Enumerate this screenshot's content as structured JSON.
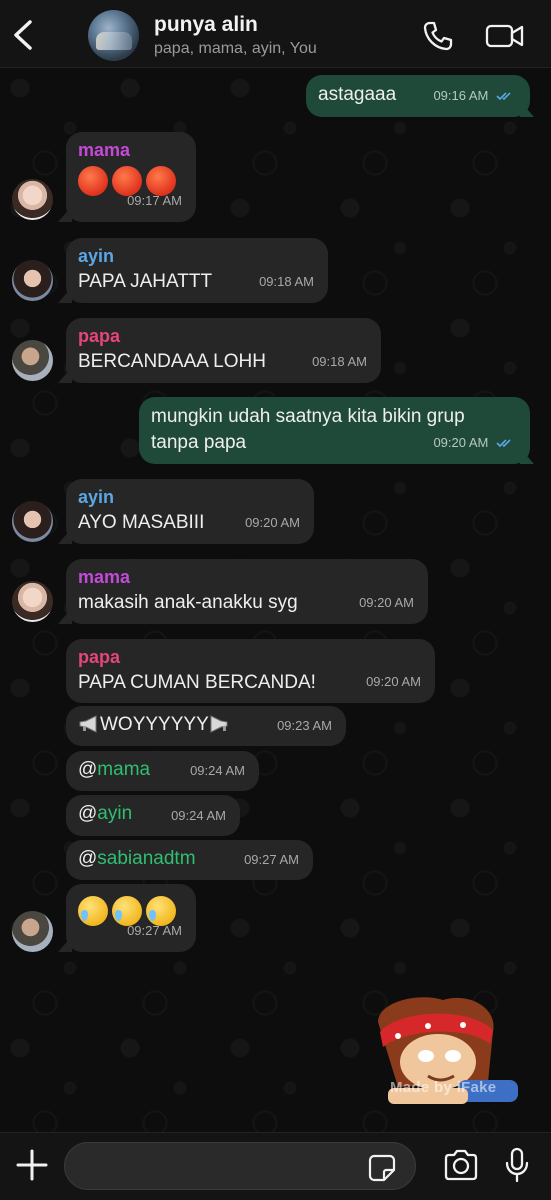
{
  "header": {
    "title": "punya alin",
    "members": "papa, mama, ayin, You",
    "back_icon": "chevron-left-icon",
    "call_icon": "phone-icon",
    "video_icon": "video-camera-icon"
  },
  "colors": {
    "incoming_bubble": "#262626",
    "outgoing_bubble": "#1f4a3a",
    "mama_name": "#c34ad8",
    "ayin_name": "#5aa6e6",
    "papa_name": "#e4457a",
    "mention": "#2fbf71",
    "read_ticks": "#5aa6e6"
  },
  "messages": [
    {
      "direction": "out",
      "text": "astagaaa",
      "time": "09:16 AM",
      "read": true
    },
    {
      "direction": "in",
      "sender": "mama",
      "text": "😡😡😡",
      "time": "09:17 AM"
    },
    {
      "direction": "in",
      "sender": "ayin",
      "text": "PAPA JAHATTT",
      "time": "09:18 AM"
    },
    {
      "direction": "in",
      "sender": "papa",
      "text": "BERCANDAAA LOHH",
      "time": "09:18 AM"
    },
    {
      "direction": "out",
      "text_line1": "mungkin udah saatnya kita bikin grup",
      "text_line2": "tanpa papa",
      "time": "09:20 AM",
      "read": true
    },
    {
      "direction": "in",
      "sender": "ayin",
      "text": "AYO MASABIII",
      "time": "09:20 AM"
    },
    {
      "direction": "in",
      "sender": "mama",
      "text": "makasih anak-anakku syg",
      "time": "09:20 AM"
    },
    {
      "direction": "in",
      "sender": "papa",
      "text": "PAPA CUMAN BERCANDA!",
      "time": "09:20 AM"
    },
    {
      "direction": "in",
      "sender": "papa",
      "text": "WOYYYYYY",
      "time": "09:23 AM"
    },
    {
      "direction": "in",
      "sender": "papa",
      "text_prefix": "@",
      "mention": "mama",
      "time": "09:24 AM"
    },
    {
      "direction": "in",
      "sender": "papa",
      "text_prefix": "@",
      "mention": "ayin",
      "time": "09:24 AM"
    },
    {
      "direction": "in",
      "sender": "papa",
      "text_prefix": "@",
      "mention": "sabianadtm",
      "time": "09:27 AM"
    },
    {
      "direction": "in",
      "sender": "papa",
      "text": "🥲🥲🥲",
      "time": "09:27 AM"
    }
  ],
  "sticker": {
    "caption": "Made by iFake"
  },
  "input": {
    "placeholder": ""
  },
  "icons": {
    "plus": "plus-icon",
    "sticker": "sticker-icon",
    "camera": "camera-icon",
    "mic": "microphone-icon"
  }
}
